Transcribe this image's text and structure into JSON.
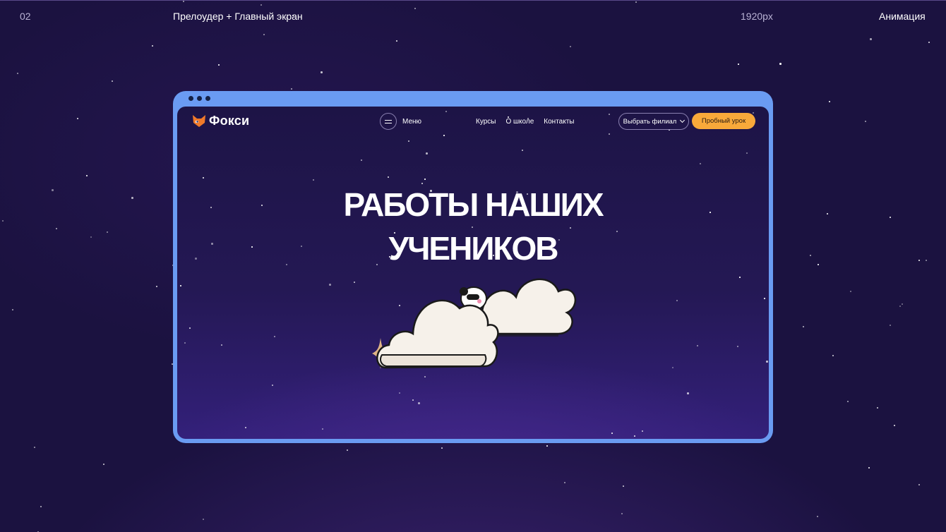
{
  "meta": {
    "number": "02",
    "title": "Прелоудер + Главный экран",
    "resolution": "1920px",
    "section": "Анимация"
  },
  "site": {
    "logo_text": "Фокси",
    "menu_label": "Меню",
    "nav": [
      "Курсы",
      "О школе",
      "Контакты"
    ],
    "branch_select": "Выбрать филиал",
    "trial_button": "Пробный урок",
    "hero_title_line1": "РАБОТЫ НАШИХ",
    "hero_title_line2": "УЧЕНИКОВ"
  },
  "icons": {
    "logo": "fox-logo-icon",
    "menu": "hamburger-icon",
    "branch": "chevron-down-icon"
  },
  "colors": {
    "accent": "#f8a93a",
    "browser_frame": "#6a9bf2",
    "background": "#1b1240"
  }
}
